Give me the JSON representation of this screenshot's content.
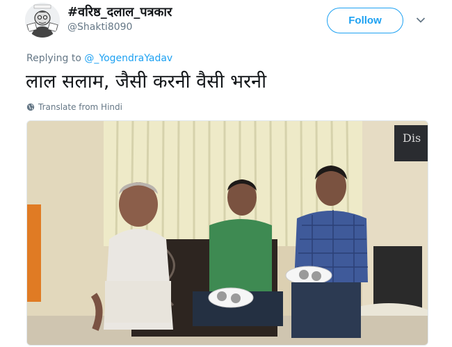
{
  "tweet": {
    "display_name": "#वरिष्ठ_दलाल_पत्रकार",
    "handle": "@Shakti8090",
    "follow_label": "Follow",
    "replying_prefix": "Replying to",
    "replying_mention": "@_YogendraYadav",
    "text": "लाल सलाम, जैसी करनी वैसी भरनी",
    "translate_label": "Translate from Hindi",
    "photo_sign_text": "Dis"
  },
  "colors": {
    "accent": "#1da1f2",
    "secondary_text": "#657786"
  },
  "icons": {
    "caret": "chevron-down-icon",
    "globe": "globe-icon"
  }
}
